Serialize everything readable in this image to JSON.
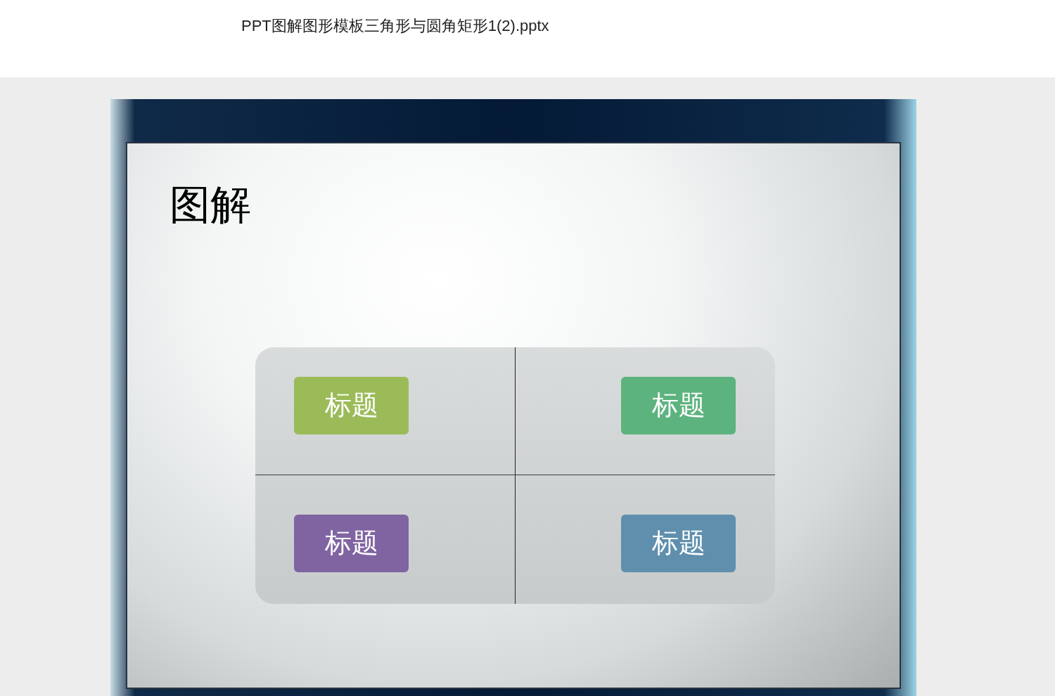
{
  "document": {
    "title": "PPT图解图形模板三角形与圆角矩形1(2).pptx"
  },
  "slide": {
    "title": "图解",
    "boxes": [
      {
        "label": "标题",
        "color": "#9bbb59"
      },
      {
        "label": "标题",
        "color": "#5db37e"
      },
      {
        "label": "标题",
        "color": "#8064a2"
      },
      {
        "label": "标题",
        "color": "#5f8fad"
      }
    ]
  }
}
